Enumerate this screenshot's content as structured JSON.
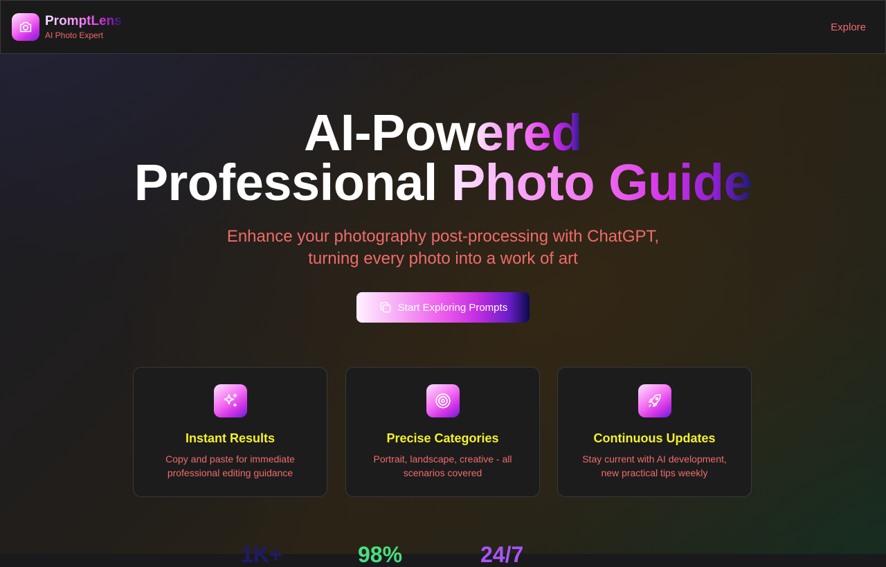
{
  "header": {
    "brand_name": "PromptLens",
    "brand_tagline": "AI Photo Expert",
    "nav_explore": "Explore"
  },
  "hero": {
    "title_line1_plain": "AI-Pow",
    "title_line1_grad": "ered",
    "title_line2_plain": "Professional ",
    "title_line2_grad": "Photo Guide",
    "subtitle_line1": "Enhance your photography post-processing with ChatGPT,",
    "subtitle_line2": "turning every photo into a work of art",
    "cta_label": "Start Exploring Prompts"
  },
  "features": [
    {
      "icon": "sparkles-icon",
      "title": "Instant Results",
      "desc": "Copy and paste for immediate professional editing guidance"
    },
    {
      "icon": "target-icon",
      "title": "Precise Categories",
      "desc": "Portrait, landscape, creative - all scenarios covered"
    },
    {
      "icon": "rocket-icon",
      "title": "Continuous Updates",
      "desc": "Stay current with AI development, new practical tips weekly"
    }
  ],
  "stats": [
    {
      "value": "1K+",
      "color": "#1e1b6b"
    },
    {
      "value": "98%",
      "color": "#4ade80"
    },
    {
      "value": "24/7",
      "color": "#a855f7"
    }
  ],
  "colors": {
    "accent_text": "#f06b6b",
    "card_title": "#f4f12a",
    "brand_gradient": [
      "#fde6ff",
      "#f06ef0",
      "#c026d3",
      "#1e1b7a"
    ]
  }
}
